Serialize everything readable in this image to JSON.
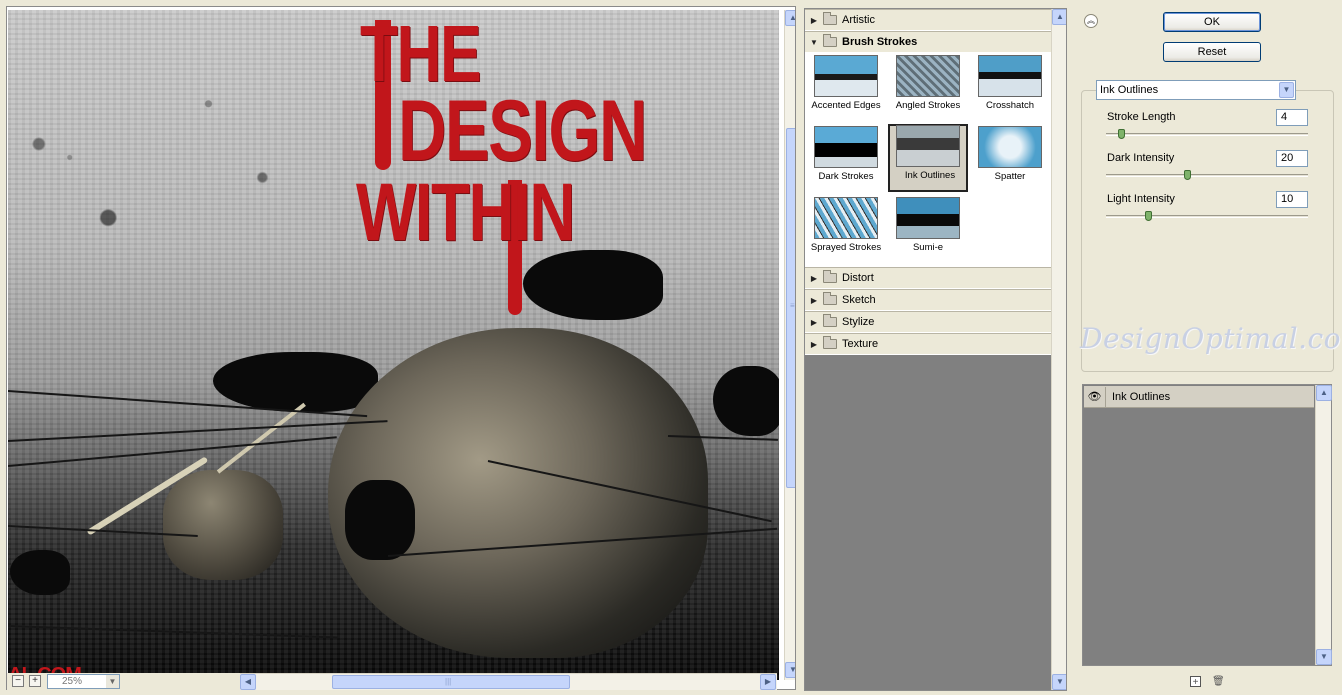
{
  "preview": {
    "poster_title_line1": "THE",
    "poster_title_line2": "DESIGN",
    "poster_title_line3": "WITHIN",
    "corner_text": "AL.COM",
    "zoom_level": "25%",
    "zoom_minus_symbol": "−",
    "zoom_plus_symbol": "+"
  },
  "gallery": {
    "categories_before": [
      {
        "label": "Artistic",
        "expanded": false
      }
    ],
    "open_category": {
      "label": "Brush Strokes",
      "expanded": true
    },
    "filters": [
      {
        "label": "Accented Edges",
        "selected": false
      },
      {
        "label": "Angled Strokes",
        "selected": false
      },
      {
        "label": "Crosshatch",
        "selected": false
      },
      {
        "label": "Dark Strokes",
        "selected": false
      },
      {
        "label": "Ink Outlines",
        "selected": true
      },
      {
        "label": "Spatter",
        "selected": false
      },
      {
        "label": "Sprayed Strokes",
        "selected": false
      },
      {
        "label": "Sumi-e",
        "selected": false
      }
    ],
    "categories_after": [
      {
        "label": "Distort",
        "expanded": false
      },
      {
        "label": "Sketch",
        "expanded": false
      },
      {
        "label": "Stylize",
        "expanded": false
      },
      {
        "label": "Texture",
        "expanded": false
      }
    ]
  },
  "settings": {
    "ok_label": "OK",
    "reset_label": "Reset",
    "selected_filter": "Ink Outlines",
    "params": [
      {
        "label": "Stroke Length",
        "value": "4",
        "min": 1,
        "max": 50,
        "fraction": 0.06
      },
      {
        "label": "Dark Intensity",
        "value": "20",
        "min": 0,
        "max": 50,
        "fraction": 0.4
      },
      {
        "label": "Light Intensity",
        "value": "10",
        "min": 0,
        "max": 50,
        "fraction": 0.2
      }
    ],
    "watermark": "DesignOptimal.com"
  },
  "layers": {
    "items": [
      {
        "label": "Ink Outlines",
        "visible": true
      }
    ]
  },
  "colors": {
    "title_red": "#c1161b",
    "dialog_bg": "#ece9d8",
    "panel_gray": "#808080",
    "scrollbar_blue": "#c5d5fb"
  }
}
